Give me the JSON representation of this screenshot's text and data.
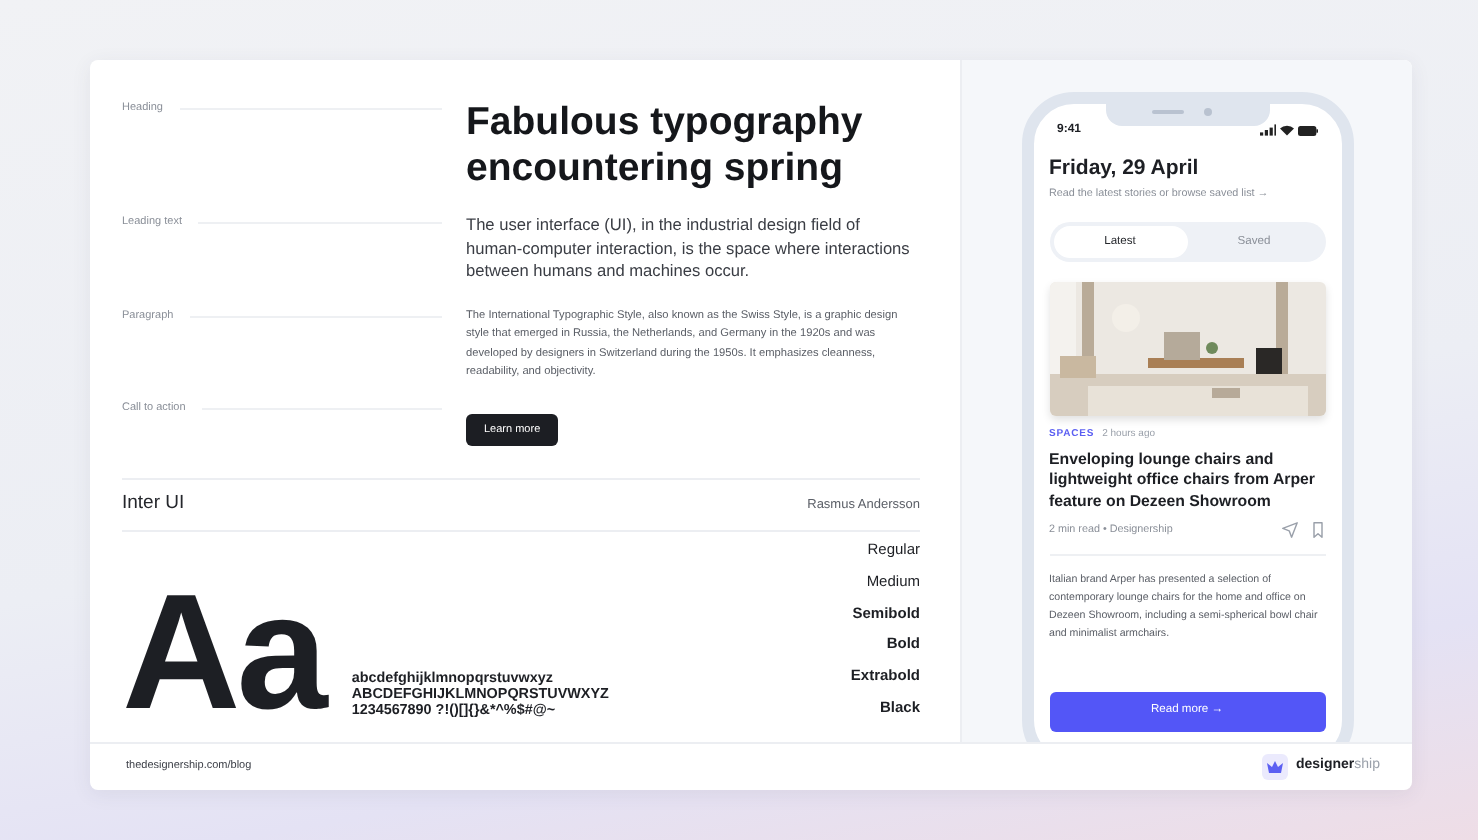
{
  "specimen": {
    "rows": [
      {
        "label": "Heading",
        "kind": "heading",
        "text": "Fabulous typography encountering spring"
      },
      {
        "label": "Leading text",
        "kind": "lead",
        "text": "The user interface (UI), in the industrial design field of human-computer interaction, is the space where interactions between humans and machines occur."
      },
      {
        "label": "Paragraph",
        "kind": "paragraph",
        "text": "The International Typographic Style, also known as the Swiss Style, is a graphic design style that emerged in Russia, the Netherlands, and Germany in the 1920s and was developed by designers in Switzerland during the 1950s. It emphasizes cleanness, readability, and objectivity."
      },
      {
        "label": "Call to action",
        "kind": "button",
        "text": "Learn more"
      }
    ]
  },
  "font": {
    "name": "Inter UI",
    "author": "Rasmus Andersson",
    "sample": "Aa",
    "glyph_lines": [
      "abcdefghijklmnopqrstuvwxyz",
      "ABCDEFGHIJKLMNOPQRSTUVWXYZ",
      "1234567890 ?!()[]{}&*^%$#@~"
    ],
    "weights": [
      "Regular",
      "Medium",
      "Semibold",
      "Bold",
      "Extrabold",
      "Black"
    ]
  },
  "phone": {
    "time": "9:41",
    "title": "Friday, 29 April",
    "subtitle": "Read the latest stories or browse saved list →",
    "tabs": [
      {
        "label": "Latest",
        "selected": true
      },
      {
        "label": "Saved",
        "selected": false
      }
    ],
    "article": {
      "category": "SPACES",
      "age": "2 hours ago",
      "title": "Enveloping lounge chairs and lightweight office chairs from Arper feature on Dezeen Showroom",
      "meta": "2 min read • Designership",
      "summary": "Italian brand Arper has presented a selection of contemporary lounge chairs for the home and office on Dezeen Showroom, including a semi-spherical bowl chair and minimalist armchairs.",
      "button": "Read more →"
    }
  },
  "footer": {
    "url": "thedesignership.com/blog",
    "logo": "**designer**ship"
  }
}
